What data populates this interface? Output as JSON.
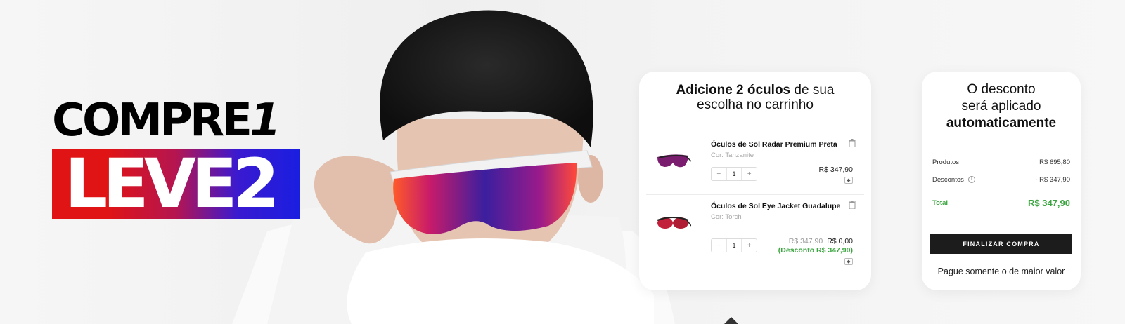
{
  "headline": {
    "line1": "COMPRE",
    "line1_num": "1",
    "line2": "LEVE2"
  },
  "cart": {
    "title_bold": "Adicione 2 óculos",
    "title_rest": "de sua",
    "title_line2": "escolha no carrinho",
    "items": [
      {
        "name": "Óculos de Sol Radar Premium Preta",
        "color": "Cor: Tanzanite",
        "qty": "1",
        "minus": "−",
        "plus": "+",
        "price": "R$ 347,90",
        "thumb_icon": "sunglasses-thumbnail"
      },
      {
        "name": "Óculos de Sol Eye Jacket Guadalupe",
        "color": "Cor: Torch",
        "qty": "1",
        "minus": "−",
        "plus": "+",
        "old_price": "R$ 347,90",
        "price": "R$ 0,00",
        "discount": "(Desconto R$ 347,90)",
        "thumb_icon": "sunglasses-thumbnail"
      }
    ]
  },
  "summary": {
    "title_line1": "O desconto",
    "title_line2": "será aplicado",
    "title_line3": "automaticamente",
    "products_label": "Produtos",
    "products_value": "R$ 695,80",
    "discounts_label": "Descontos",
    "discounts_value": "- R$ 347,90",
    "total_label": "Total",
    "total_value": "R$ 347,90",
    "checkout_label": "FINALIZAR COMPRA",
    "note": "Pague somente o de maior valor"
  },
  "colors": {
    "accent_green": "#3aa53f",
    "banner_red": "#e01414",
    "banner_blue": "#1a1ee0",
    "button_dark": "#1c1c1c"
  }
}
